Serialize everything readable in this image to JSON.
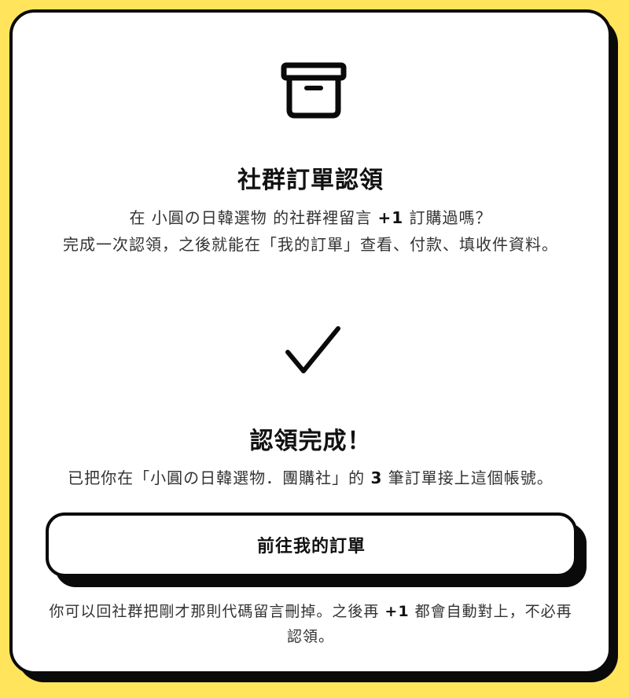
{
  "icons": {
    "top": "archive-box-icon",
    "status": "checkmark-icon"
  },
  "claim": {
    "title": "社群訂單認領",
    "desc_line1_prefix": "在 小圓の日韓選物 的社群裡留言 ",
    "desc_line1_bold": "+1",
    "desc_line1_suffix": " 訂購過嗎？",
    "desc_line2": "完成一次認領，之後就能在「我的訂單」查看、付款、填收件資料。"
  },
  "success": {
    "title": "認領完成！",
    "desc_prefix": "已把你在「小圓の日韓選物．團購社」的 ",
    "desc_count": "3",
    "desc_suffix": " 筆訂單接上這個帳號。"
  },
  "button": {
    "label": "前往我的訂單"
  },
  "footer": {
    "prefix": "你可以回社群把剛才那則代碼留言刪掉。之後再 ",
    "bold": "+1",
    "suffix": " 都會自動對上，不必再認領。"
  },
  "colors": {
    "background": "#FFE45C",
    "card": "#FFFFFF",
    "border": "#0A0A0A"
  }
}
